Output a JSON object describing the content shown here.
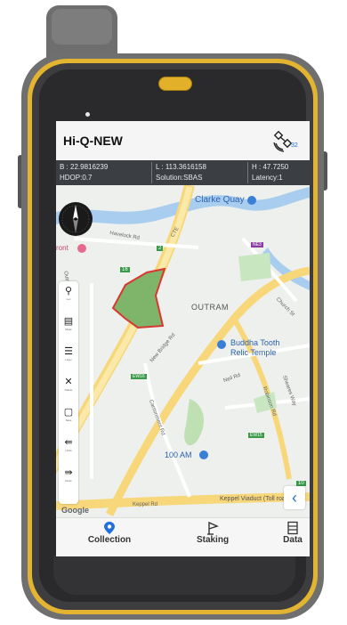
{
  "app": {
    "title": "Hi-Q-NEW",
    "satellite_count": "32"
  },
  "status": {
    "b": "B : 22.9816239",
    "l": "L : 113.3616158",
    "h": "H : 47.7250",
    "hdop": "HDOP:0.7",
    "solution": "Solution:SBAS",
    "latency": "Latency:1"
  },
  "map": {
    "labels": {
      "clarke_quay": "Clarke Quay",
      "outram": "OUTRAM",
      "buddha_tooth": "Buddha Tooth",
      "relic_temple": "Relic Temple",
      "havelock_rd": "Havelock Rd",
      "cte": "CTE",
      "new_bridge_rd": "New Bridge Rd",
      "cantonment_rd": "Cantonment Rd",
      "outram_rd": "Outram Rd",
      "front": "ront",
      "church_st": "Church St",
      "neil_rd": "Neil Rd",
      "keppel_viaduct": "Keppel Viaduct (Toll road)",
      "keppel_rd": "Keppel Rd",
      "sheares": "Sheares Way",
      "robinson_rd": "Robinson Rd",
      "am_100": "100 AM",
      "google": "Google",
      "badge_16": "16",
      "badge_2": "2",
      "badge_ne3": "NE3",
      "badge_ew16": "EW16",
      "badge_ew15": "EW15",
      "badge_10": "10"
    },
    "polygon_fill": "#7fb56a",
    "polygon_stroke": "#d8382f"
  },
  "toolbar": {
    "tools": [
      {
        "icon": "person-location-icon",
        "label": "Loc"
      },
      {
        "icon": "measure-icon",
        "label": "Meas"
      },
      {
        "icon": "layers-icon",
        "label": "Layer"
      },
      {
        "icon": "delete-icon",
        "label": "Delete"
      },
      {
        "icon": "save-icon",
        "label": "Save"
      },
      {
        "icon": "undo-icon",
        "label": "Undo"
      },
      {
        "icon": "redo-icon",
        "label": "Redo"
      }
    ]
  },
  "nav": {
    "collection": "Collection",
    "staking": "Staking",
    "data": "Data",
    "accent": "#1f6fe0"
  }
}
